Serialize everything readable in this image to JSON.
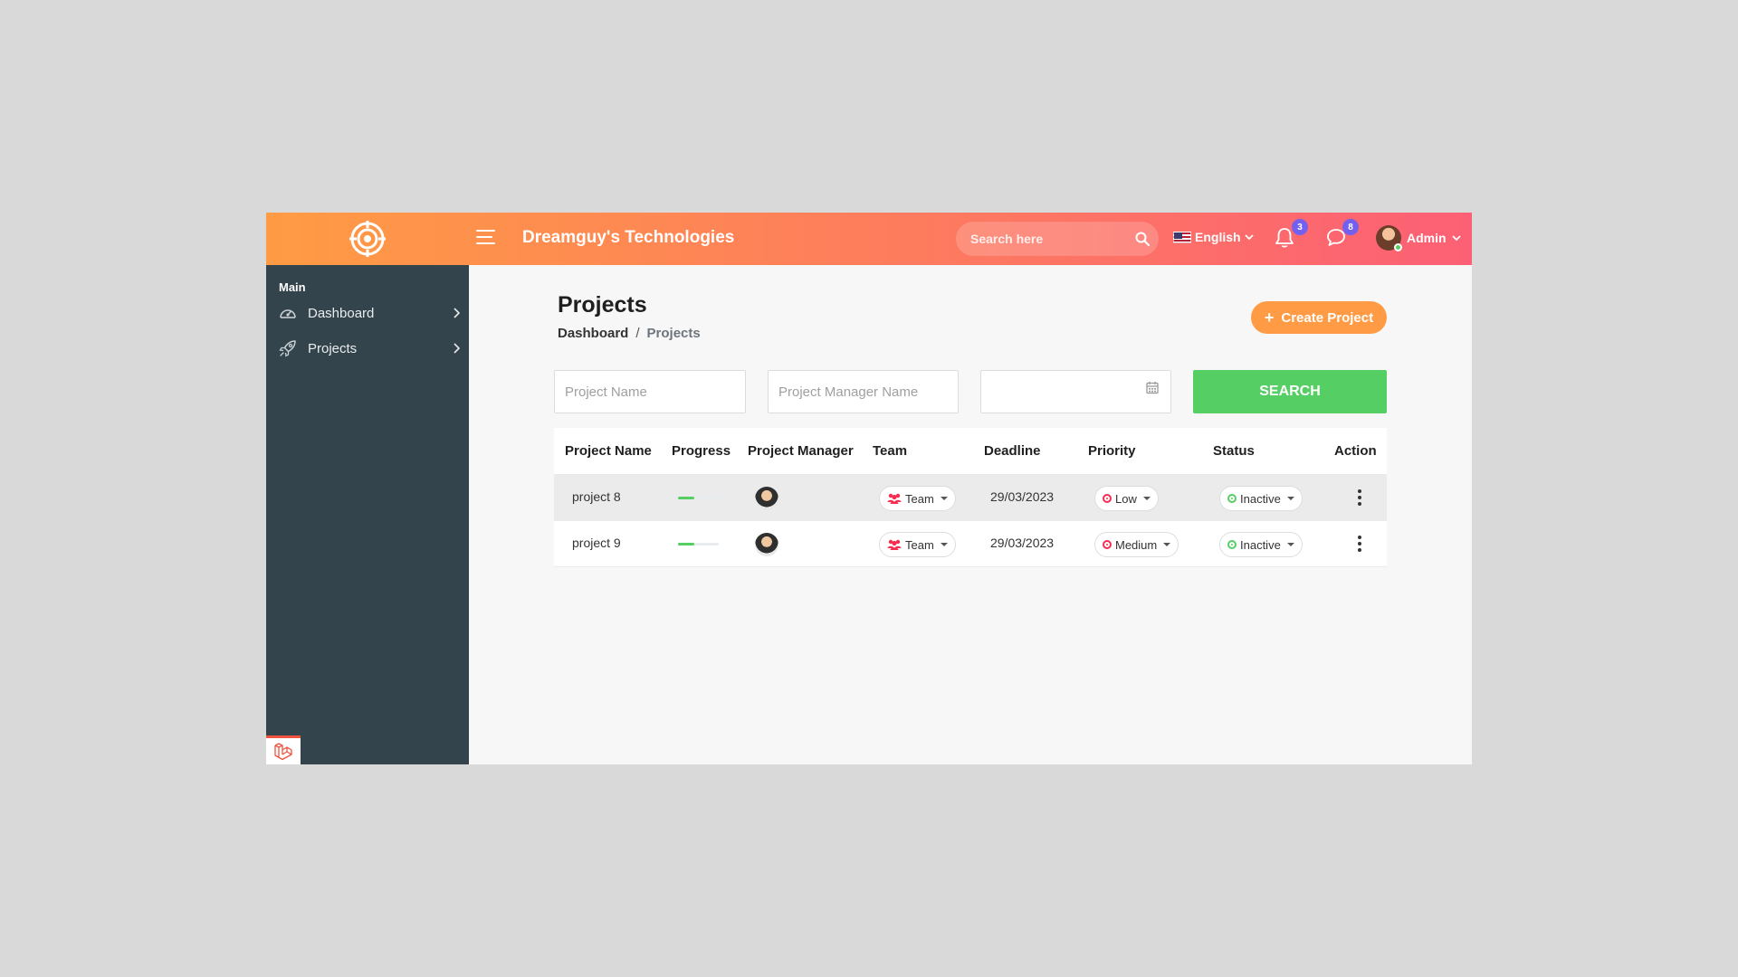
{
  "colors": {
    "header_gradient_start": "#ff9b44",
    "header_gradient_end": "#fc6075",
    "sidebar_bg": "#34444c",
    "accent_orange": "#ff9b44",
    "success_green": "#55ce63",
    "badge_purple": "#7460ee",
    "danger_red": "#f62d51"
  },
  "header": {
    "logo_icon": "target-logo-icon",
    "menu_icon": "hamburger-icon",
    "company_name": "Dreamguy's Technologies",
    "search_placeholder": "Search here",
    "search_icon": "search-icon",
    "language": "English",
    "notifications_count": "3",
    "messages_count": "8",
    "user_name": "Admin"
  },
  "sidebar": {
    "section_title": "Main",
    "items": [
      {
        "label": "Dashboard",
        "icon": "dashboard-gauge-icon"
      },
      {
        "label": "Projects",
        "icon": "rocket-icon"
      }
    ]
  },
  "page": {
    "title": "Projects",
    "breadcrumb": {
      "home": "Dashboard",
      "separator": "/",
      "current": "Projects"
    },
    "create_button": "Create Project"
  },
  "filters": {
    "project_name_placeholder": "Project Name",
    "manager_name_placeholder": "Project Manager Name",
    "date_value": "",
    "search_button": "SEARCH"
  },
  "table": {
    "headers": [
      "Project Name",
      "Progress",
      "Project Manager",
      "Team",
      "Deadline",
      "Priority",
      "Status",
      "Action"
    ],
    "rows": [
      {
        "name": "project 8",
        "progress": 0.4,
        "team": "Team",
        "deadline": "29/03/2023",
        "priority": "Low",
        "status": "Inactive"
      },
      {
        "name": "project 9",
        "progress": 0.4,
        "team": "Team",
        "deadline": "29/03/2023",
        "priority": "Medium",
        "status": "Inactive"
      }
    ]
  }
}
